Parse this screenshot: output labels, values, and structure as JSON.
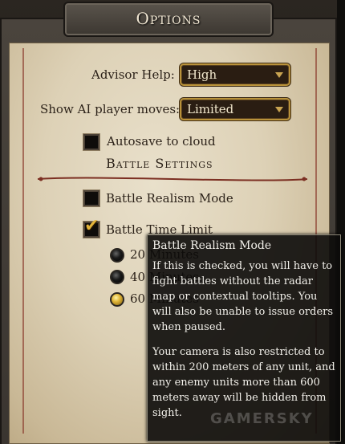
{
  "window": {
    "title": "Options"
  },
  "options": {
    "advisor_help": {
      "label": "Advisor Help:",
      "value": "High"
    },
    "show_ai_moves": {
      "label": "Show AI player moves:",
      "value": "Limited"
    },
    "autosave": {
      "label": "Autosave to cloud",
      "checked": false
    }
  },
  "battle_settings": {
    "heading": "Battle Settings",
    "realism_mode": {
      "label": "Battle Realism Mode",
      "checked": false
    },
    "time_limit": {
      "label": "Battle Time Limit",
      "checked": true,
      "options": [
        {
          "label": "20 Minutes",
          "selected": false
        },
        {
          "label": "40 Minutes",
          "selected": false
        },
        {
          "label": "60 Minutes",
          "selected": true
        }
      ]
    }
  },
  "tooltip": {
    "title": "Battle Realism Mode",
    "paragraph1": "If this is checked, you will have to fight battles without the radar map or contextual tooltips. You will also be unable to issue orders when paused.",
    "paragraph2": "Your camera is also restricted to within 200 meters of any unit, and any enemy units more than 600 meters away will be hidden from sight."
  },
  "watermark": "GAMERSKY",
  "colors": {
    "accent_gold": "#e3b43a",
    "dropdown_border": "#b9923a",
    "text_dark": "#2c2219",
    "tooltip_bg": "#0c0b0a"
  }
}
